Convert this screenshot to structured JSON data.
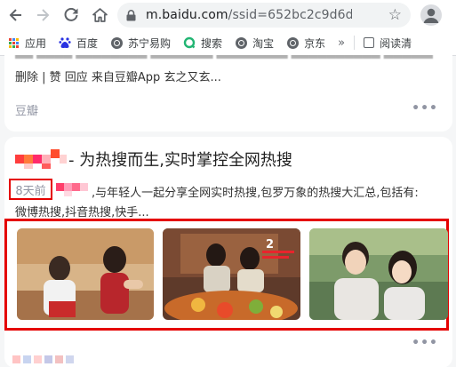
{
  "browser": {
    "url_host": "m.baidu.com",
    "url_path": "/ssid=652bc2c9d6deb..."
  },
  "bookmarks": {
    "items": [
      {
        "label": "应用",
        "icon": "apps-grid-icon"
      },
      {
        "label": "百度",
        "icon": "baidu-paw-icon"
      },
      {
        "label": "苏宁易购",
        "icon": "globe-icon"
      },
      {
        "label": "搜索",
        "icon": "search-ring-icon"
      },
      {
        "label": "淘宝",
        "icon": "globe-icon"
      },
      {
        "label": "京东",
        "icon": "globe-icon"
      }
    ],
    "overflow": "»",
    "reading_list": "阅读清"
  },
  "prev_result": {
    "snippet": "删除 | 赞 回应 来自豆瓣App 玄之又玄...",
    "source": "豆瓣",
    "more": "•••"
  },
  "result": {
    "title": "- 为热搜而生,实时掌控全网热搜",
    "date": "8天前",
    "desc_line1": ",与年轻人一起分享全网实时热搜,包罗万象的热搜大汇总,包括有:",
    "desc_line2": "微博热搜,抖音热搜,快手...",
    "more": "•••",
    "thumbnail_count": 3
  },
  "colors": {
    "highlight_red": "#e50000",
    "muted_text": "#9195a3",
    "page_bg": "#f5f6f7"
  }
}
